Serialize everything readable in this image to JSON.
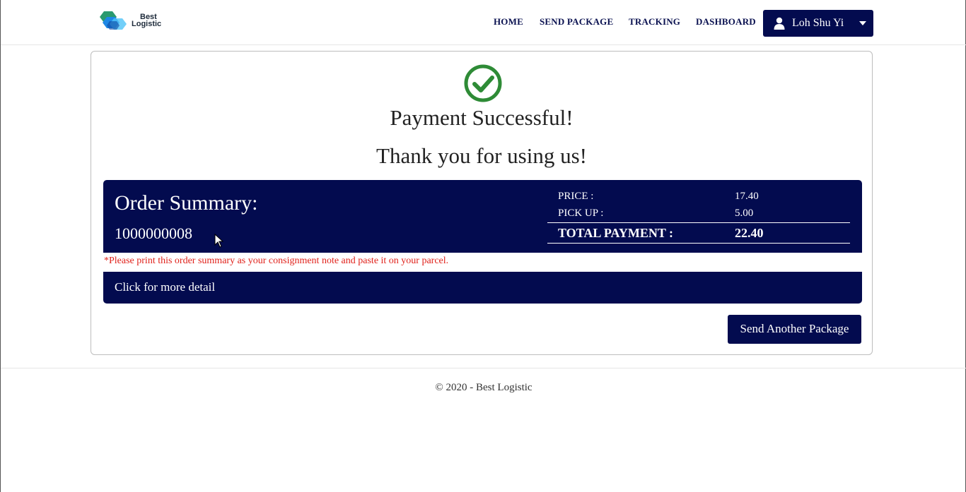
{
  "header": {
    "logo_line1": "Best",
    "logo_line2": "Logistic",
    "nav": [
      "HOME",
      "SEND PACKAGE",
      "TRACKING",
      "DASHBOARD"
    ],
    "user_name": "Loh Shu Yi"
  },
  "payment": {
    "title": "Payment Successful!",
    "subtitle": "Thank you for using us!",
    "status_icon": "check-circle-icon",
    "status_color": "#2e8b36"
  },
  "summary": {
    "title": "Order Summary:",
    "order_number": "1000000008",
    "price_label": "PRICE :",
    "price_value": "17.40",
    "pickup_label": "PICK UP :",
    "pickup_value": "5.00",
    "total_label": "TOTAL PAYMENT :",
    "total_value": "22.40",
    "note": "*Please print this order summary as your consignment note and paste it on your parcel.",
    "more_detail": "Click for more detail"
  },
  "actions": {
    "send_another": "Send Another Package"
  },
  "footer": {
    "copyright": "© 2020 - Best Logistic"
  },
  "colors": {
    "primary": "#030b4f",
    "note": "#e0221b"
  }
}
